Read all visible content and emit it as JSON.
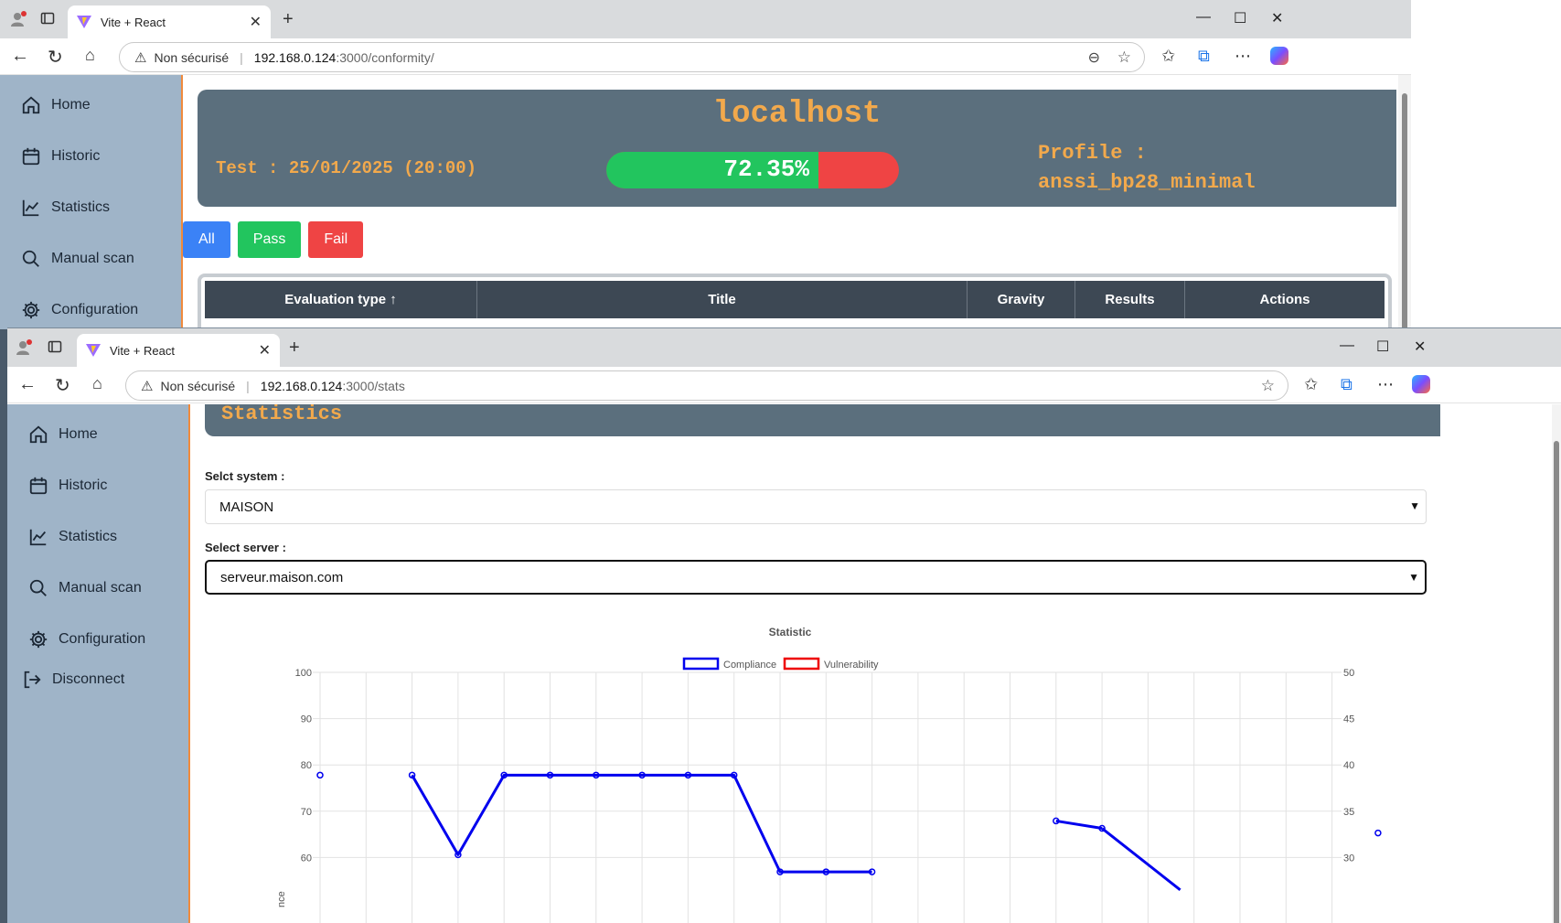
{
  "win1": {
    "tab_title": "Vite + React",
    "not_secure": "Non sécurisé",
    "url_host": "192.168.0.124",
    "url_path": ":3000/conformity/",
    "sidebar": [
      {
        "label": "Home",
        "icon": "home-icon"
      },
      {
        "label": "Historic",
        "icon": "calendar-icon"
      },
      {
        "label": "Statistics",
        "icon": "chart-line-icon"
      },
      {
        "label": "Manual scan",
        "icon": "search-icon"
      },
      {
        "label": "Configuration",
        "icon": "gear-icon"
      }
    ],
    "hero": {
      "host": "localhost",
      "test_label": "Test : 25/01/2025 (20:00)",
      "progress_value": 72.35,
      "progress_text": "72.35%",
      "profile_label": "Profile :",
      "profile_value": "anssi_bp28_minimal"
    },
    "filters": [
      {
        "label": "All",
        "color": "#3b82f6"
      },
      {
        "label": "Pass",
        "color": "#22c55e"
      },
      {
        "label": "Fail",
        "color": "#ef4444"
      }
    ],
    "table_headers": [
      "Evaluation type ↑",
      "Title",
      "Gravity",
      "Results",
      "Actions"
    ]
  },
  "win2": {
    "tab_title": "Vite + React",
    "not_secure": "Non sécurisé",
    "url_host": "192.168.0.124",
    "url_path": ":3000/stats",
    "sidebar": [
      {
        "label": "Home",
        "icon": "home-icon"
      },
      {
        "label": "Historic",
        "icon": "calendar-icon"
      },
      {
        "label": "Statistics",
        "icon": "chart-line-icon"
      },
      {
        "label": "Manual scan",
        "icon": "search-icon"
      },
      {
        "label": "Configuration",
        "icon": "gear-icon"
      },
      {
        "label": "Disconnect",
        "icon": "logout-icon"
      }
    ],
    "page_title": "Statistics",
    "system_label": "Selct system :",
    "system_value": "MAISON",
    "server_label": "Select server :",
    "server_value": "serveur.maison.com"
  },
  "colors": {
    "compliance": "#0000ee",
    "vulnerability": "#ee0000",
    "accent": "#f2a94c",
    "sidebar_bg": "#9fb4c8",
    "hero_bg": "#5b6f7d"
  },
  "chart_data": {
    "type": "line",
    "title": "Statistic",
    "legend_position": "top",
    "grid": true,
    "series": [
      {
        "name": "Compliance",
        "axis": "left",
        "values": [
          77.8,
          null,
          null,
          null,
          77.8,
          60.6,
          77.8,
          77.8,
          77.8,
          77.8,
          77.8,
          77.8,
          56.9,
          56.9,
          56.9,
          null,
          null,
          null,
          67.9,
          66.3,
          null,
          null,
          null,
          null,
          null,
          65.3
        ],
        "partial_tail": [
          [
            19,
            66.3
          ],
          [
            20.7,
            53
          ]
        ]
      },
      {
        "name": "Vulnerability",
        "axis": "right",
        "values": []
      }
    ],
    "x_count": 23,
    "y_left": {
      "min": 50,
      "max": 100,
      "ticks": [
        100,
        90,
        80,
        70,
        60
      ]
    },
    "y_right": {
      "min": 25,
      "max": 50,
      "ticks": [
        50,
        45,
        40,
        35,
        30
      ]
    },
    "ylabel_fragment": "nce"
  }
}
